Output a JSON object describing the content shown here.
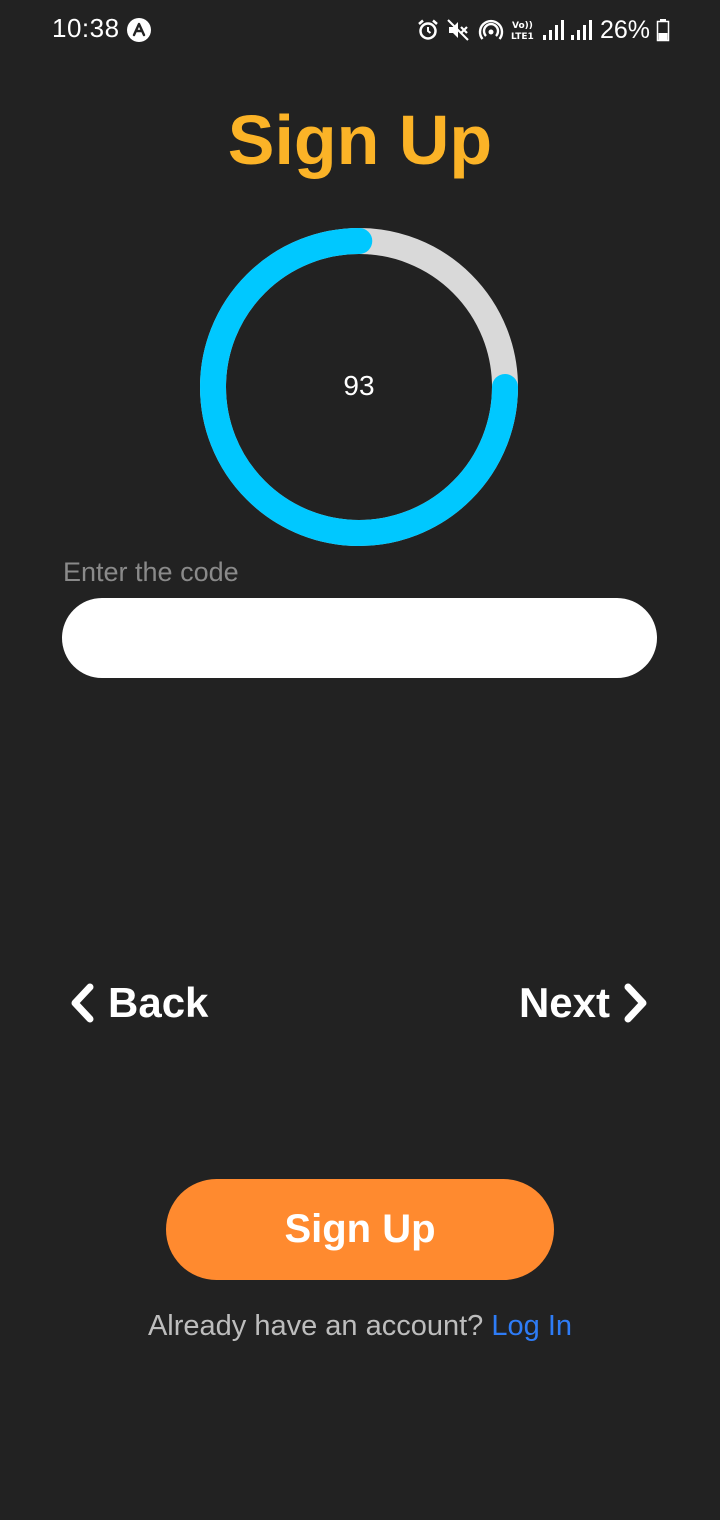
{
  "status_bar": {
    "time": "10:38",
    "battery": "26%",
    "network_label": "Vo))\nLTE1",
    "icons": [
      "alarm-icon",
      "mute-icon",
      "hotspot-icon",
      "volte-icon",
      "signal-icon",
      "signal-icon",
      "battery-icon"
    ]
  },
  "title": "Sign Up",
  "timer": {
    "value": "93",
    "progress_fraction": 0.75,
    "progress_color": "#00c8ff",
    "track_color": "#d9d9d9"
  },
  "code": {
    "label": "Enter the code",
    "value": "",
    "placeholder": ""
  },
  "nav": {
    "back_label": "Back",
    "next_label": "Next"
  },
  "signup_button": "Sign Up",
  "login_prompt": {
    "text": "Already have an account?",
    "link": "Log In"
  },
  "colors": {
    "background": "#222222",
    "title": "#fbb327",
    "button": "#ff8a2f",
    "link": "#2e7cf6"
  }
}
